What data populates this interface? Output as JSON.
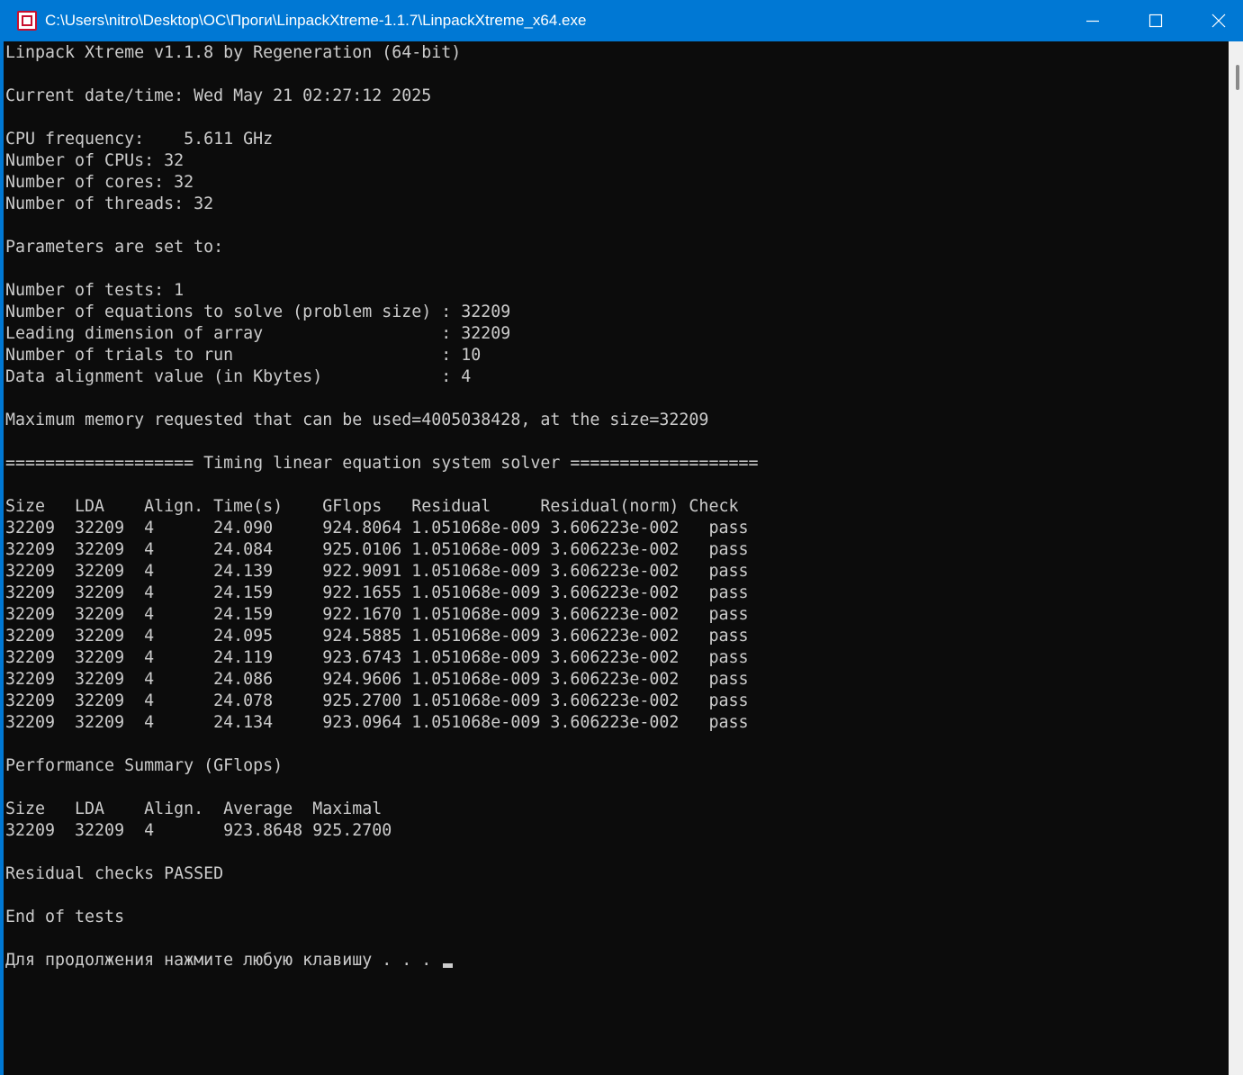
{
  "window": {
    "title": "C:\\Users\\nitro\\Desktop\\OC\\Проги\\LinpackXtreme-1.1.7\\LinpackXtreme_x64.exe",
    "icon": "linpack-app-icon",
    "controls": [
      "minimize-icon",
      "maximize-icon",
      "close-icon"
    ],
    "accent_color": "#0078d4"
  },
  "console": {
    "background": "#0c0c0c",
    "foreground": "#cccccc",
    "lines": [
      "Linpack Xtreme v1.1.8 by Regeneration (64-bit)",
      "",
      "Current date/time: Wed May 21 02:27:12 2025",
      "",
      "CPU frequency:    5.611 GHz",
      "Number of CPUs: 32",
      "Number of cores: 32",
      "Number of threads: 32",
      "",
      "Parameters are set to:",
      "",
      "Number of tests: 1",
      "Number of equations to solve (problem size) : 32209",
      "Leading dimension of array                  : 32209",
      "Number of trials to run                     : 10",
      "Data alignment value (in Kbytes)            : 4",
      "",
      "Maximum memory requested that can be used=4005038428, at the size=32209",
      "",
      "=================== Timing linear equation system solver ===================",
      "",
      "Size   LDA    Align. Time(s)    GFlops   Residual     Residual(norm) Check",
      "32209  32209  4      24.090     924.8064 1.051068e-009 3.606223e-002   pass",
      "32209  32209  4      24.084     925.0106 1.051068e-009 3.606223e-002   pass",
      "32209  32209  4      24.139     922.9091 1.051068e-009 3.606223e-002   pass",
      "32209  32209  4      24.159     922.1655 1.051068e-009 3.606223e-002   pass",
      "32209  32209  4      24.159     922.1670 1.051068e-009 3.606223e-002   pass",
      "32209  32209  4      24.095     924.5885 1.051068e-009 3.606223e-002   pass",
      "32209  32209  4      24.119     923.6743 1.051068e-009 3.606223e-002   pass",
      "32209  32209  4      24.086     924.9606 1.051068e-009 3.606223e-002   pass",
      "32209  32209  4      24.078     925.2700 1.051068e-009 3.606223e-002   pass",
      "32209  32209  4      24.134     923.0964 1.051068e-009 3.606223e-002   pass",
      "",
      "Performance Summary (GFlops)",
      "",
      "Size   LDA    Align.  Average  Maximal",
      "32209  32209  4       923.8648 925.2700",
      "",
      "Residual checks PASSED",
      "",
      "End of tests",
      "",
      "Для продолжения нажмите любую клавишу . . . "
    ]
  }
}
